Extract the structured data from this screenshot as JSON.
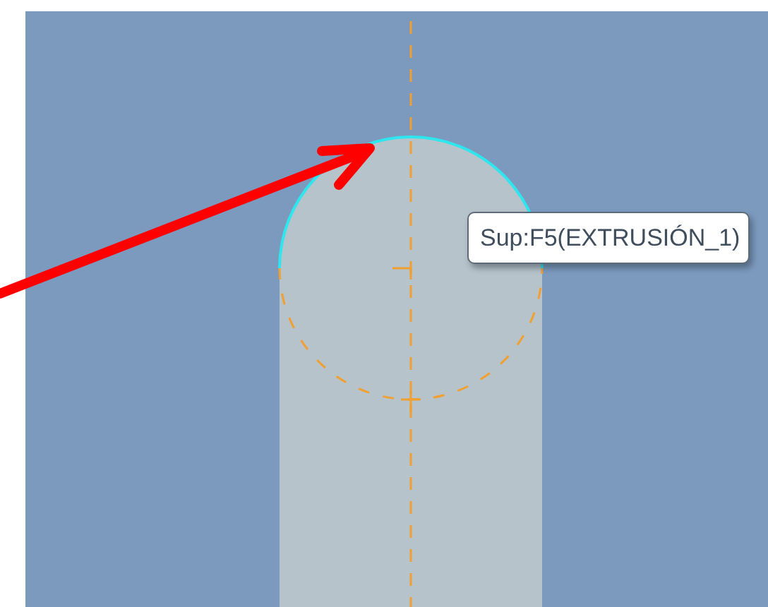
{
  "tooltip": {
    "text": "Sup:F5(EXTRUSIÓN_1)"
  }
}
